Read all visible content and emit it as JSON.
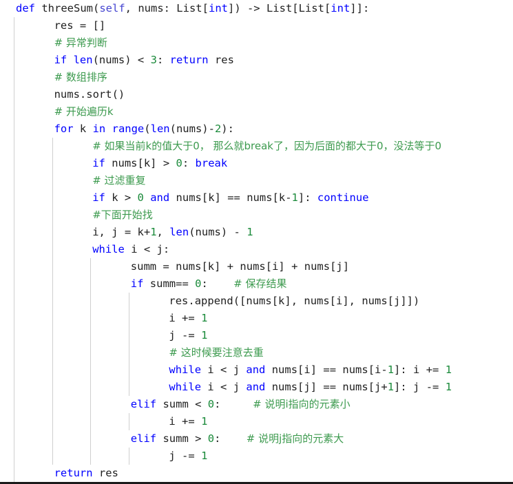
{
  "editor": {
    "language": "Python",
    "theme": "light",
    "background_color": "#ffffff",
    "indent_guide_color": "#cfcfcf",
    "bottom_border_color": "#1a1a1a",
    "colors": {
      "keyword": "#0000ff",
      "builtin": "#0000ff",
      "self": "#4444d0",
      "number": "#1a8a3a",
      "comment": "#3c9a4e",
      "plain": "#202020"
    },
    "line_height_px": 25,
    "indent_guide_x": [
      20,
      75,
      131,
      186,
      242,
      297,
      353
    ]
  },
  "code": {
    "lines": [
      {
        "indent": 0,
        "tokens": [
          {
            "t": "def",
            "k": "kw"
          },
          {
            "t": " threeSum(",
            "k": "pl"
          },
          {
            "t": "self",
            "k": "self"
          },
          {
            "t": ", nums: List[",
            "k": "pl"
          },
          {
            "t": "int",
            "k": "bi"
          },
          {
            "t": "]) -> List[List[",
            "k": "pl"
          },
          {
            "t": "int",
            "k": "bi"
          },
          {
            "t": "]]:",
            "k": "pl"
          }
        ]
      },
      {
        "indent": 1,
        "tokens": [
          {
            "t": "res = []",
            "k": "pl"
          }
        ]
      },
      {
        "indent": 1,
        "tokens": [
          {
            "t": "# 异常判断",
            "k": "cmt",
            "cjk": true
          }
        ]
      },
      {
        "indent": 1,
        "tokens": [
          {
            "t": "if ",
            "k": "kw"
          },
          {
            "t": "len",
            "k": "bi"
          },
          {
            "t": "(nums) < ",
            "k": "pl"
          },
          {
            "t": "3",
            "k": "num"
          },
          {
            "t": ": ",
            "k": "pl"
          },
          {
            "t": "return",
            "k": "kw"
          },
          {
            "t": " res",
            "k": "pl"
          }
        ]
      },
      {
        "indent": 1,
        "tokens": [
          {
            "t": "# 数组排序",
            "k": "cmt",
            "cjk": true
          }
        ]
      },
      {
        "indent": 1,
        "tokens": [
          {
            "t": "nums.sort()",
            "k": "pl"
          }
        ]
      },
      {
        "indent": 1,
        "tokens": [
          {
            "t": "# 开始遍历k",
            "k": "cmt",
            "cjk": true
          }
        ]
      },
      {
        "indent": 1,
        "tokens": [
          {
            "t": "for",
            "k": "kw"
          },
          {
            "t": " k ",
            "k": "pl"
          },
          {
            "t": "in",
            "k": "kw"
          },
          {
            "t": " ",
            "k": "pl"
          },
          {
            "t": "range",
            "k": "bi"
          },
          {
            "t": "(",
            "k": "pl"
          },
          {
            "t": "len",
            "k": "bi"
          },
          {
            "t": "(nums)-",
            "k": "pl"
          },
          {
            "t": "2",
            "k": "num"
          },
          {
            "t": "):",
            "k": "pl"
          }
        ]
      },
      {
        "indent": 2,
        "tokens": [
          {
            "t": "# 如果当前k的值大于0， 那么就break了，因为后面的都大于0，没法等于0",
            "k": "cmt",
            "cjk": true
          }
        ]
      },
      {
        "indent": 2,
        "tokens": [
          {
            "t": "if",
            "k": "kw"
          },
          {
            "t": " nums[k] > ",
            "k": "pl"
          },
          {
            "t": "0",
            "k": "num"
          },
          {
            "t": ": ",
            "k": "pl"
          },
          {
            "t": "break",
            "k": "kw"
          }
        ]
      },
      {
        "indent": 2,
        "tokens": [
          {
            "t": "# 过滤重复",
            "k": "cmt",
            "cjk": true
          }
        ]
      },
      {
        "indent": 2,
        "tokens": [
          {
            "t": "if",
            "k": "kw"
          },
          {
            "t": " k > ",
            "k": "pl"
          },
          {
            "t": "0",
            "k": "num"
          },
          {
            "t": " ",
            "k": "pl"
          },
          {
            "t": "and",
            "k": "kw"
          },
          {
            "t": " nums[k] == nums[k-",
            "k": "pl"
          },
          {
            "t": "1",
            "k": "num"
          },
          {
            "t": "]: ",
            "k": "pl"
          },
          {
            "t": "continue",
            "k": "kw"
          }
        ]
      },
      {
        "indent": 2,
        "tokens": [
          {
            "t": "#下面开始找",
            "k": "cmt",
            "cjk": true
          }
        ]
      },
      {
        "indent": 2,
        "tokens": [
          {
            "t": "i, j = k+",
            "k": "pl"
          },
          {
            "t": "1",
            "k": "num"
          },
          {
            "t": ", ",
            "k": "pl"
          },
          {
            "t": "len",
            "k": "bi"
          },
          {
            "t": "(nums) - ",
            "k": "pl"
          },
          {
            "t": "1",
            "k": "num"
          }
        ]
      },
      {
        "indent": 2,
        "tokens": [
          {
            "t": "while",
            "k": "kw"
          },
          {
            "t": " i < j:",
            "k": "pl"
          }
        ]
      },
      {
        "indent": 3,
        "tokens": [
          {
            "t": "summ = nums[k] + nums[i] + nums[j]",
            "k": "pl"
          }
        ]
      },
      {
        "indent": 3,
        "tokens": [
          {
            "t": "if",
            "k": "kw"
          },
          {
            "t": " summ== ",
            "k": "pl"
          },
          {
            "t": "0",
            "k": "num"
          },
          {
            "t": ":    ",
            "k": "pl"
          },
          {
            "t": "# 保存结果",
            "k": "cmt",
            "cjk": true
          }
        ]
      },
      {
        "indent": 4,
        "tokens": [
          {
            "t": "res.append([nums[k], nums[i], nums[j]])",
            "k": "pl"
          }
        ]
      },
      {
        "indent": 4,
        "tokens": [
          {
            "t": "i += ",
            "k": "pl"
          },
          {
            "t": "1",
            "k": "num"
          }
        ]
      },
      {
        "indent": 4,
        "tokens": [
          {
            "t": "j -= ",
            "k": "pl"
          },
          {
            "t": "1",
            "k": "num"
          }
        ]
      },
      {
        "indent": 4,
        "tokens": [
          {
            "t": "# 这时候要注意去重",
            "k": "cmt",
            "cjk": true
          }
        ]
      },
      {
        "indent": 4,
        "tokens": [
          {
            "t": "while",
            "k": "kw"
          },
          {
            "t": " i < j ",
            "k": "pl"
          },
          {
            "t": "and",
            "k": "kw"
          },
          {
            "t": " nums[i] == nums[i-",
            "k": "pl"
          },
          {
            "t": "1",
            "k": "num"
          },
          {
            "t": "]: i += ",
            "k": "pl"
          },
          {
            "t": "1",
            "k": "num"
          }
        ]
      },
      {
        "indent": 4,
        "tokens": [
          {
            "t": "while",
            "k": "kw"
          },
          {
            "t": " i < j ",
            "k": "pl"
          },
          {
            "t": "and",
            "k": "kw"
          },
          {
            "t": " nums[j] == nums[j+",
            "k": "pl"
          },
          {
            "t": "1",
            "k": "num"
          },
          {
            "t": "]: j -= ",
            "k": "pl"
          },
          {
            "t": "1",
            "k": "num"
          }
        ]
      },
      {
        "indent": 3,
        "tokens": [
          {
            "t": "elif",
            "k": "kw"
          },
          {
            "t": " summ < ",
            "k": "pl"
          },
          {
            "t": "0",
            "k": "num"
          },
          {
            "t": ":     ",
            "k": "pl"
          },
          {
            "t": "# 说明i指向的元素小",
            "k": "cmt",
            "cjk": true
          }
        ]
      },
      {
        "indent": 4,
        "tokens": [
          {
            "t": "i += ",
            "k": "pl"
          },
          {
            "t": "1",
            "k": "num"
          }
        ]
      },
      {
        "indent": 3,
        "tokens": [
          {
            "t": "elif",
            "k": "kw"
          },
          {
            "t": " summ > ",
            "k": "pl"
          },
          {
            "t": "0",
            "k": "num"
          },
          {
            "t": ":    ",
            "k": "pl"
          },
          {
            "t": "# 说明j指向的元素大",
            "k": "cmt",
            "cjk": true
          }
        ]
      },
      {
        "indent": 4,
        "tokens": [
          {
            "t": "j -= ",
            "k": "pl"
          },
          {
            "t": "1",
            "k": "num"
          }
        ]
      },
      {
        "indent": 1,
        "tokens": [
          {
            "t": "return",
            "k": "kw"
          },
          {
            "t": " res",
            "k": "pl"
          }
        ]
      }
    ]
  }
}
